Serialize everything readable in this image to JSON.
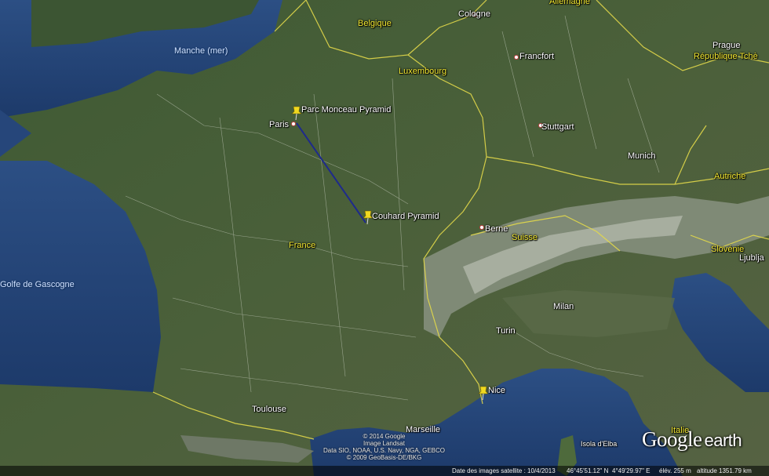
{
  "cities": [
    {
      "id": "cologne",
      "name": "Cologne"
    },
    {
      "id": "francfort",
      "name": "Francfort"
    },
    {
      "id": "prague",
      "name": "Prague"
    },
    {
      "id": "stuttgart",
      "name": "Stuttgart"
    },
    {
      "id": "munich",
      "name": "Munich"
    },
    {
      "id": "paris",
      "name": "Paris"
    },
    {
      "id": "berne",
      "name": "Berne"
    },
    {
      "id": "milan",
      "name": "Milan"
    },
    {
      "id": "turin",
      "name": "Turin"
    },
    {
      "id": "toulouse",
      "name": "Toulouse"
    },
    {
      "id": "marseille",
      "name": "Marseille"
    },
    {
      "id": "ljubljana",
      "name": "Ljublja"
    },
    {
      "id": "isola-elba",
      "name": "Isola d'Elba"
    }
  ],
  "countries": [
    {
      "id": "allemagne",
      "name": "Allemagne"
    },
    {
      "id": "belgique",
      "name": "Belgique"
    },
    {
      "id": "luxembourg",
      "name": "Luxembourg"
    },
    {
      "id": "republique-tcheque",
      "name": "République Tchè"
    },
    {
      "id": "autriche",
      "name": "Autriche"
    },
    {
      "id": "suisse",
      "name": "Suisse"
    },
    {
      "id": "france",
      "name": "France"
    },
    {
      "id": "slovenie",
      "name": "Slovénie"
    },
    {
      "id": "italie",
      "name": "Italie"
    }
  ],
  "seas": [
    {
      "id": "manche",
      "name": "Manche (mer)"
    },
    {
      "id": "golfe-gascogne",
      "name": "Golfe de Gascogne"
    }
  ],
  "placemarks": [
    {
      "id": "parc-monceau",
      "name": "Parc Monceau Pyramid"
    },
    {
      "id": "couhard",
      "name": "Couhard Pyramid"
    },
    {
      "id": "nice",
      "name": "Nice"
    }
  ],
  "credits": {
    "line1": "© 2014 Google",
    "line2": "Image Landsat",
    "line3": "Data SIO, NOAA, U.S. Navy, NGA, GEBCO",
    "line4": "© 2009 GeoBasis-DE/BKG"
  },
  "status": {
    "imagery_date": "Date des images satellite : 10/4/2013",
    "latitude": "46°45'51.12\" N",
    "longitude": "4°49'29.97\" E",
    "elevation": "élév.  255 m",
    "altitude": "altitude 1351.79 km"
  },
  "logo": {
    "word1": "Google",
    "word2": "earth"
  },
  "colors": {
    "path_line": "#1e2a8c",
    "country_label": "#f2e832",
    "border": "#e3d94a"
  }
}
